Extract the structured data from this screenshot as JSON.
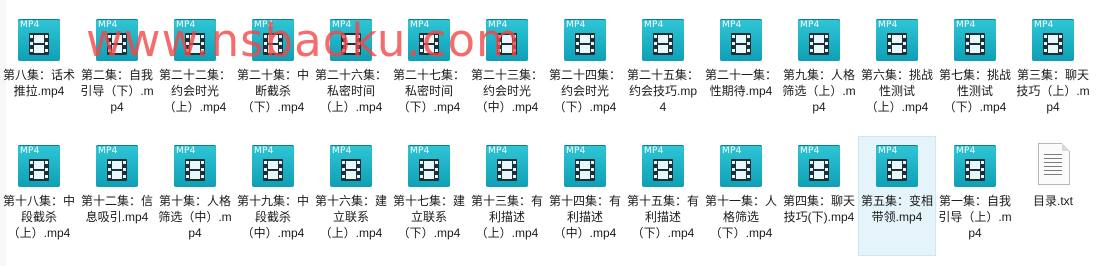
{
  "watermark": "www.nsbaoku.com",
  "file_type_tag": "MP4",
  "rows": [
    [
      {
        "name": "第八集：话术推拉.mp4",
        "type": "mp4"
      },
      {
        "name": "第二集：自我引导（下）.mp4",
        "type": "mp4"
      },
      {
        "name": "第二十二集：约会时光（上）.mp4",
        "type": "mp4"
      },
      {
        "name": "第二十集：中断截杀（下）.mp4",
        "type": "mp4"
      },
      {
        "name": "第二十六集：私密时间（上）.mp4",
        "type": "mp4"
      },
      {
        "name": "第二十七集：私密时间（下）.mp4",
        "type": "mp4"
      },
      {
        "name": "第二十三集：约会时光（中）.mp4",
        "type": "mp4"
      },
      {
        "name": "第二十四集：约会时光（下）.mp4",
        "type": "mp4"
      },
      {
        "name": "第二十五集：约会技巧.mp4",
        "type": "mp4"
      },
      {
        "name": "第二十一集：性期待.mp4",
        "type": "mp4"
      },
      {
        "name": "第九集：人格筛选（上）.mp4",
        "type": "mp4"
      },
      {
        "name": "第六集：挑战性测试（上）.mp4",
        "type": "mp4"
      },
      {
        "name": "第七集：挑战性测试（下）.mp4",
        "type": "mp4"
      },
      {
        "name": "第三集：聊天技巧（上）.mp4",
        "type": "mp4"
      }
    ],
    [
      {
        "name": "第十八集：中段截杀（上）.mp4",
        "type": "mp4"
      },
      {
        "name": "第十二集：信息吸引.mp4",
        "type": "mp4"
      },
      {
        "name": "第十集：人格筛选（中）.mp4",
        "type": "mp4"
      },
      {
        "name": "第十九集：中段截杀（中）.mp4",
        "type": "mp4"
      },
      {
        "name": "第十六集：建立联系（上）.mp4",
        "type": "mp4"
      },
      {
        "name": "第十七集：建立联系（下）.mp4",
        "type": "mp4"
      },
      {
        "name": "第十三集：有利描述（上）.mp4",
        "type": "mp4"
      },
      {
        "name": "第十四集：有利描述（中）.mp4",
        "type": "mp4"
      },
      {
        "name": "第十五集：有利描述（下）.mp4",
        "type": "mp4"
      },
      {
        "name": "第十一集：人格筛选（下）.mp4",
        "type": "mp4"
      },
      {
        "name": "第四集：聊天技巧(下).mp4",
        "type": "mp4"
      },
      {
        "name": "第五集：变相带领.mp4",
        "type": "mp4",
        "selected": true
      },
      {
        "name": "第一集：自我引导（上）.mp4",
        "type": "mp4"
      },
      {
        "name": "目录.txt",
        "type": "txt"
      }
    ]
  ]
}
